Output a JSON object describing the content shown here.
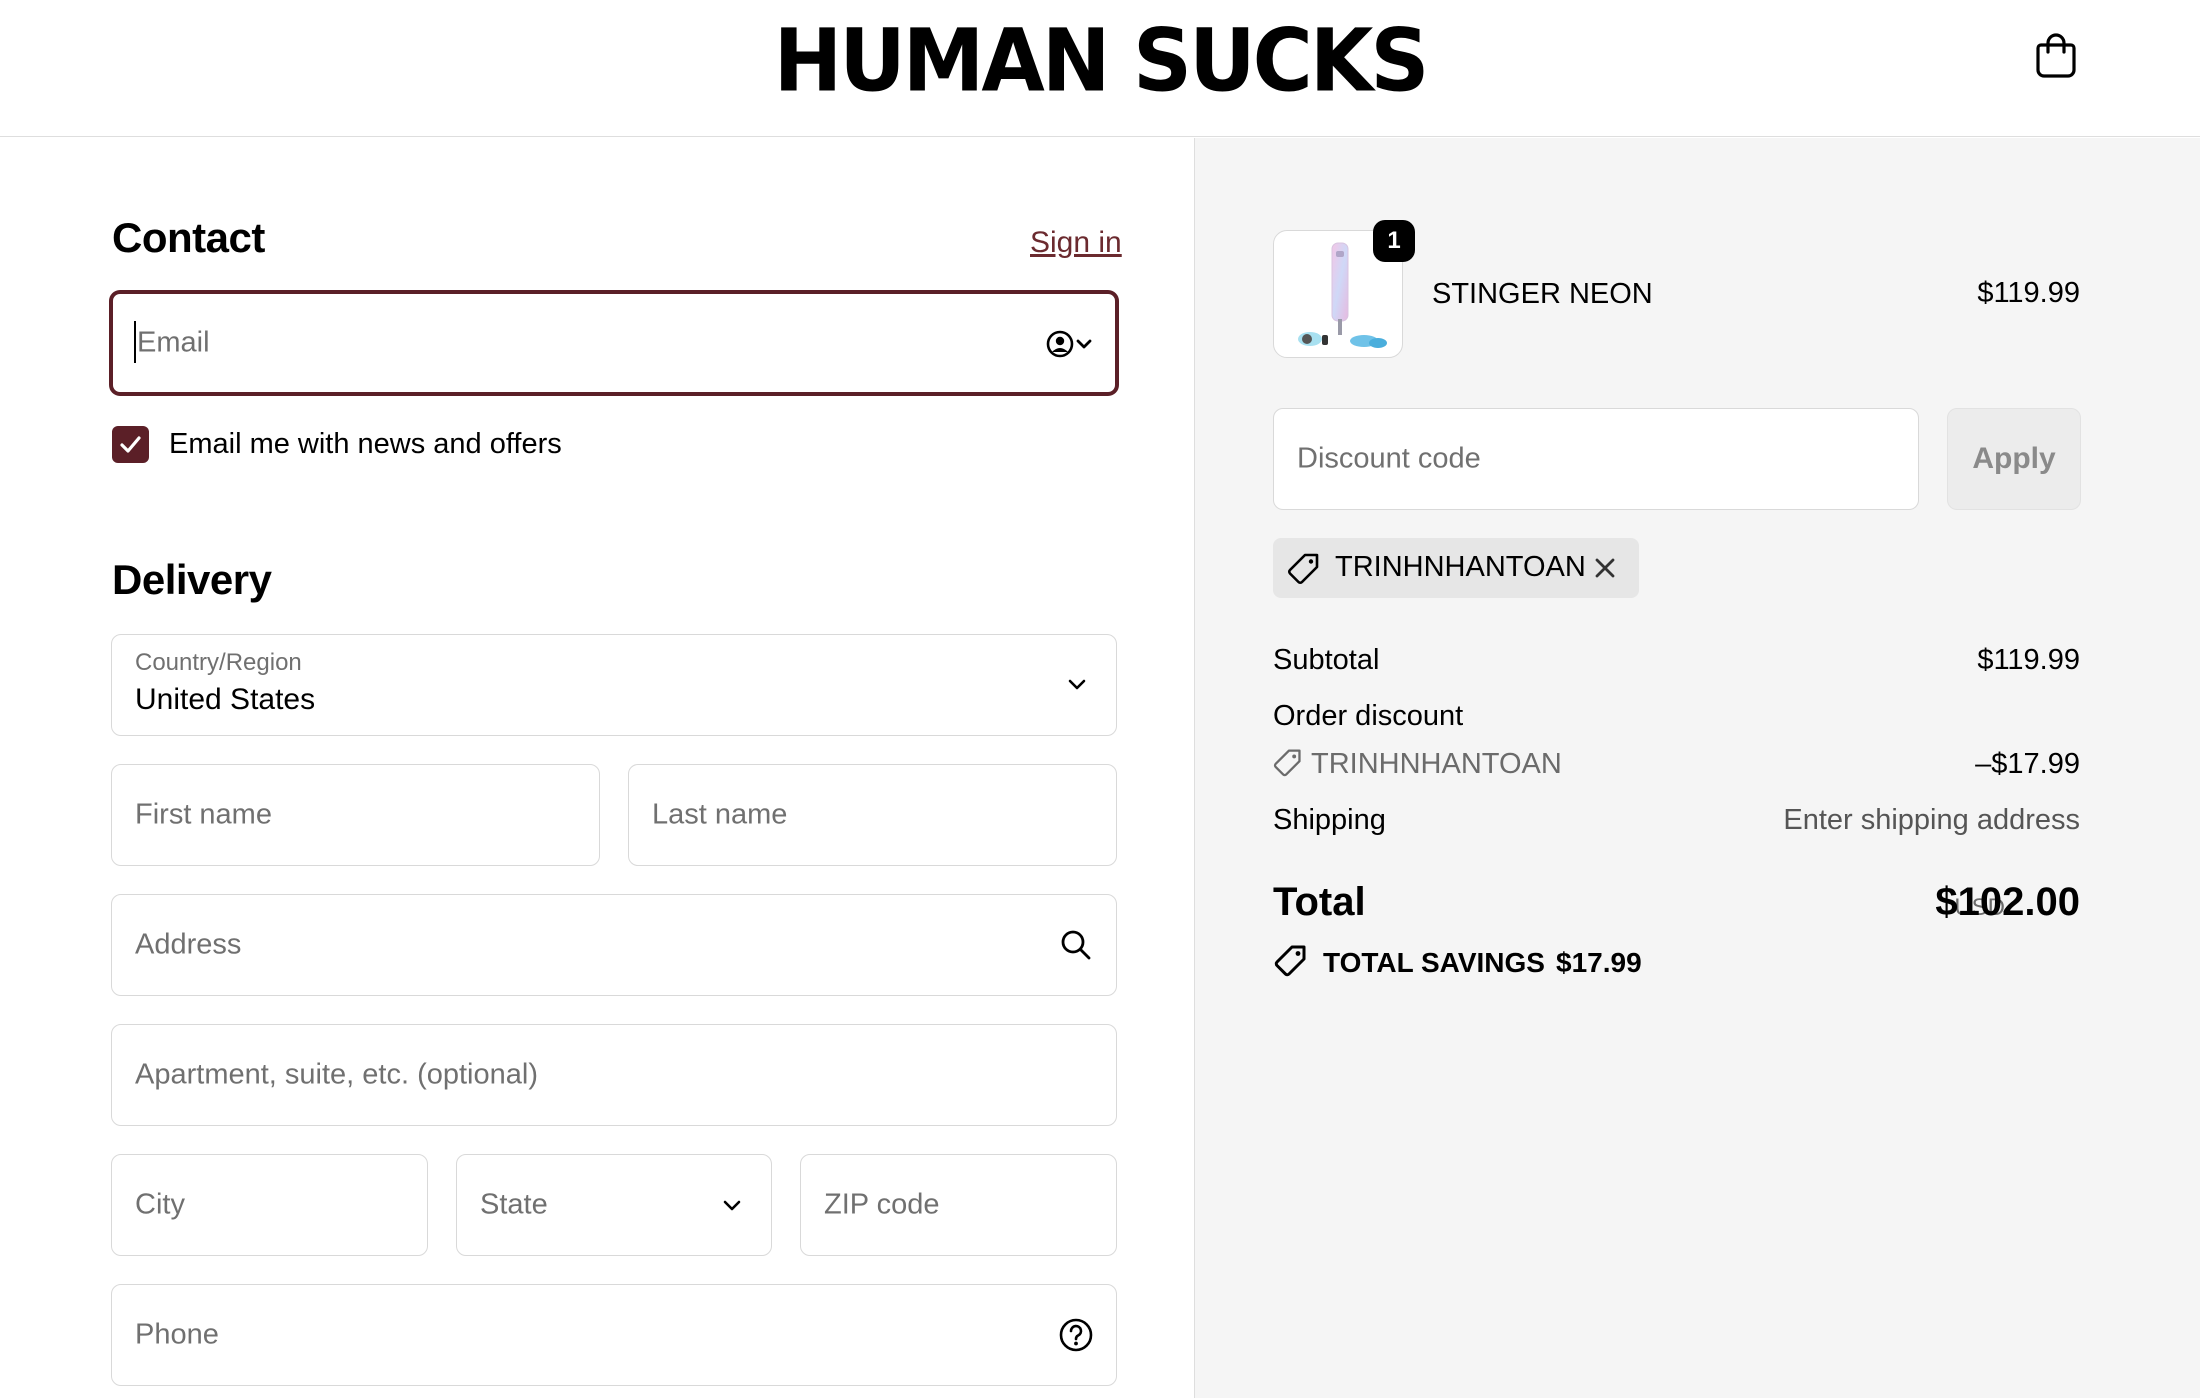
{
  "header": {
    "logo": "HUMAN SUCKS",
    "cart_icon": "shopping-bag-icon"
  },
  "contact": {
    "title": "Contact",
    "sign_in": "Sign in",
    "email_placeholder": "Email",
    "email_icon": "account-switch-icon",
    "newsletter_checked": true,
    "newsletter_label": "Email me with news and offers"
  },
  "delivery": {
    "title": "Delivery",
    "country_label": "Country/Region",
    "country_value": "United States",
    "first_name_placeholder": "First name",
    "last_name_placeholder": "Last name",
    "address_placeholder": "Address",
    "apartment_placeholder": "Apartment, suite, etc. (optional)",
    "city_placeholder": "City",
    "state_placeholder": "State",
    "zip_placeholder": "ZIP code",
    "phone_placeholder": "Phone"
  },
  "summary": {
    "item": {
      "name": "STINGER NEON",
      "price": "$119.99",
      "quantity": "1"
    },
    "discount_placeholder": "Discount code",
    "apply_label": "Apply",
    "applied_code": "TRINHNHANTOAN",
    "subtotal_label": "Subtotal",
    "subtotal_value": "$119.99",
    "order_discount_label": "Order discount",
    "order_discount_code": "TRINHNHANTOAN",
    "order_discount_value": "–$17.99",
    "shipping_label": "Shipping",
    "shipping_value": "Enter shipping address",
    "total_label": "Total",
    "currency": "USD",
    "total_value": "$102.00",
    "savings_label": "TOTAL SAVINGS",
    "savings_value": "$17.99"
  },
  "colors": {
    "accent": "#5b1f27",
    "link": "#6b2a2f",
    "summary_bg": "#f5f5f5"
  }
}
